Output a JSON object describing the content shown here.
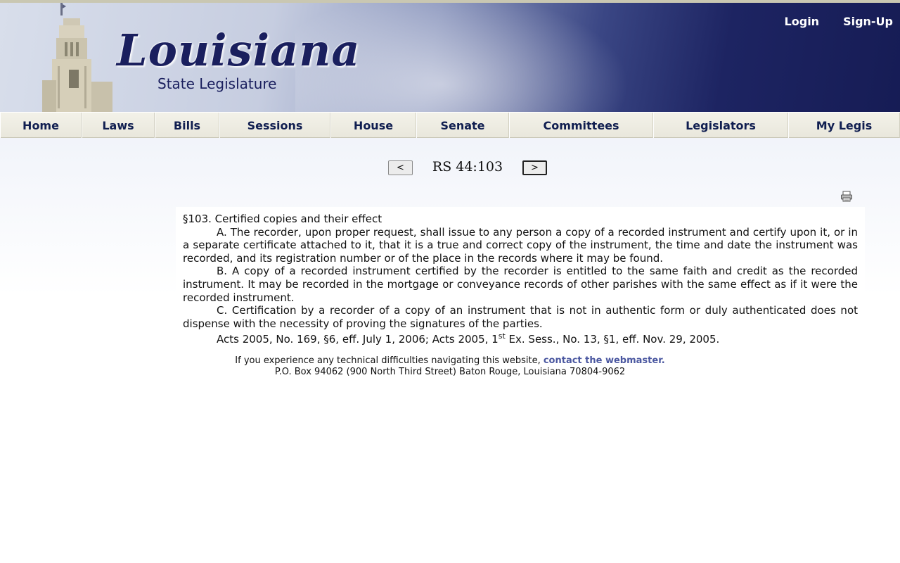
{
  "header": {
    "logo_title": "Louisiana",
    "logo_subtitle": "State Legislature",
    "links": {
      "login": "Login",
      "signup": "Sign-Up"
    }
  },
  "nav": {
    "items": [
      "Home",
      "Laws",
      "Bills",
      "Sessions",
      "House",
      "Senate",
      "Committees",
      "Legislators",
      "My Legis"
    ]
  },
  "doc_nav": {
    "prev_label": "<",
    "next_label": ">",
    "title": "RS 44:103"
  },
  "print_icon": "printer-icon",
  "document": {
    "heading": "§103.  Certified copies and their effect",
    "paragraphs": [
      "A.  The recorder, upon proper request, shall issue to any person a copy of a recorded instrument and certify upon it, or in a separate certificate attached to it, that it is a true and correct copy of the instrument, the time and date the instrument was recorded, and its registration number or of the place in the records where it may be found.",
      "B.  A copy of a recorded instrument certified by the recorder is entitled to the same faith and credit as the recorded instrument.  It may be recorded in the mortgage or conveyance records of other parishes with the same effect as if it were the recorded instrument.",
      "C.  Certification by a recorder of a copy of an instrument that is not in authentic form or duly authenticated does not dispense with the necessity of proving the signatures of the parties."
    ],
    "history_before": "Acts 2005, No. 169, §6, eff. July 1, 2006; Acts 2005, 1",
    "history_sup": "st",
    "history_after": " Ex. Sess., No. 13, §1, eff. Nov. 29, 2005."
  },
  "footer": {
    "difficulty_text": "If you experience any technical difficulties navigating this website, ",
    "webmaster_link": "contact the webmaster.",
    "address": "P.O. Box 94062 (900 North Third Street) Baton Rouge, Louisiana 70804-9062"
  },
  "colors": {
    "header_dark": "#161c55",
    "nav_text": "#101e50",
    "link": "#4a57a0"
  }
}
